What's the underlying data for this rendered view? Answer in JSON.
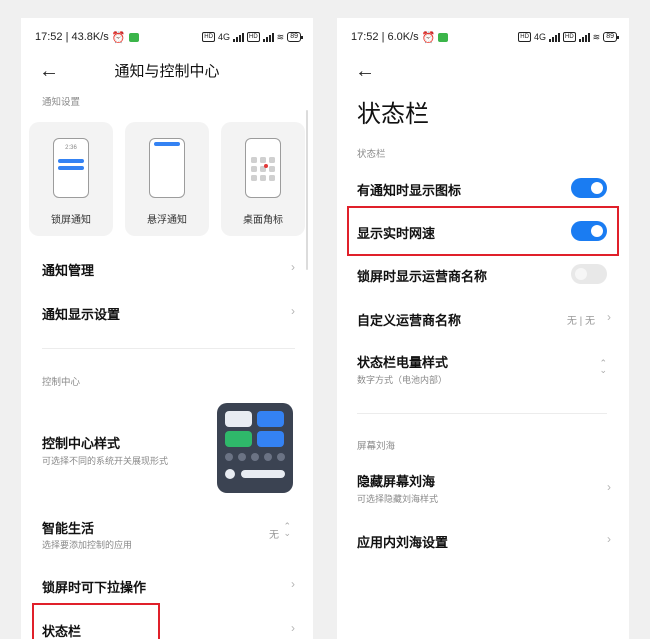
{
  "left": {
    "status_bar": {
      "time_speed": "17:52 | 43.8K/s",
      "alarm": "⏰",
      "net": "4G",
      "battery": "89"
    },
    "header_title": "通知与控制中心",
    "notif_section_label": "通知设置",
    "cards": [
      {
        "label": "锁屏通知",
        "mini_time": "2:36"
      },
      {
        "label": "悬浮通知"
      },
      {
        "label": "桌面角标"
      }
    ],
    "notif_manage": "通知管理",
    "notif_display": "通知显示设置",
    "cc_section_label": "控制中心",
    "cc_style_title": "控制中心样式",
    "cc_style_sub": "可选择不同的系统开关展现形式",
    "smart_life_title": "智能生活",
    "smart_life_sub": "选择要添加控制的应用",
    "smart_life_value": "无",
    "lock_pull_title": "锁屏时可下拉操作",
    "status_bar_title": "状态栏"
  },
  "right": {
    "status_bar": {
      "time_speed": "17:52 | 6.0K/s",
      "alarm": "⏰",
      "net": "4G",
      "battery": "89"
    },
    "page_title": "状态栏",
    "section_status_label": "状态栏",
    "show_icon_title": "有通知时显示图标",
    "show_icon_on": true,
    "net_speed_title": "显示实时网速",
    "net_speed_on": true,
    "carrier_lock_title": "锁屏时显示运营商名称",
    "carrier_lock_on": false,
    "custom_carrier_title": "自定义运营商名称",
    "custom_carrier_value": "无 | 无",
    "battery_style_title": "状态栏电量样式",
    "battery_style_sub": "数字方式（电池内部）",
    "notch_section_label": "屏幕刘海",
    "hide_notch_title": "隐藏屏幕刘海",
    "hide_notch_sub": "可选择隐藏刘海样式",
    "app_notch_title": "应用内刘海设置"
  },
  "colors": {
    "accent": "#1a7cf2",
    "highlight": "#e0202a",
    "wechat": "#3bb54a"
  },
  "icons": {
    "back": "←",
    "chevron": "›",
    "updown": "⌃⌄"
  }
}
